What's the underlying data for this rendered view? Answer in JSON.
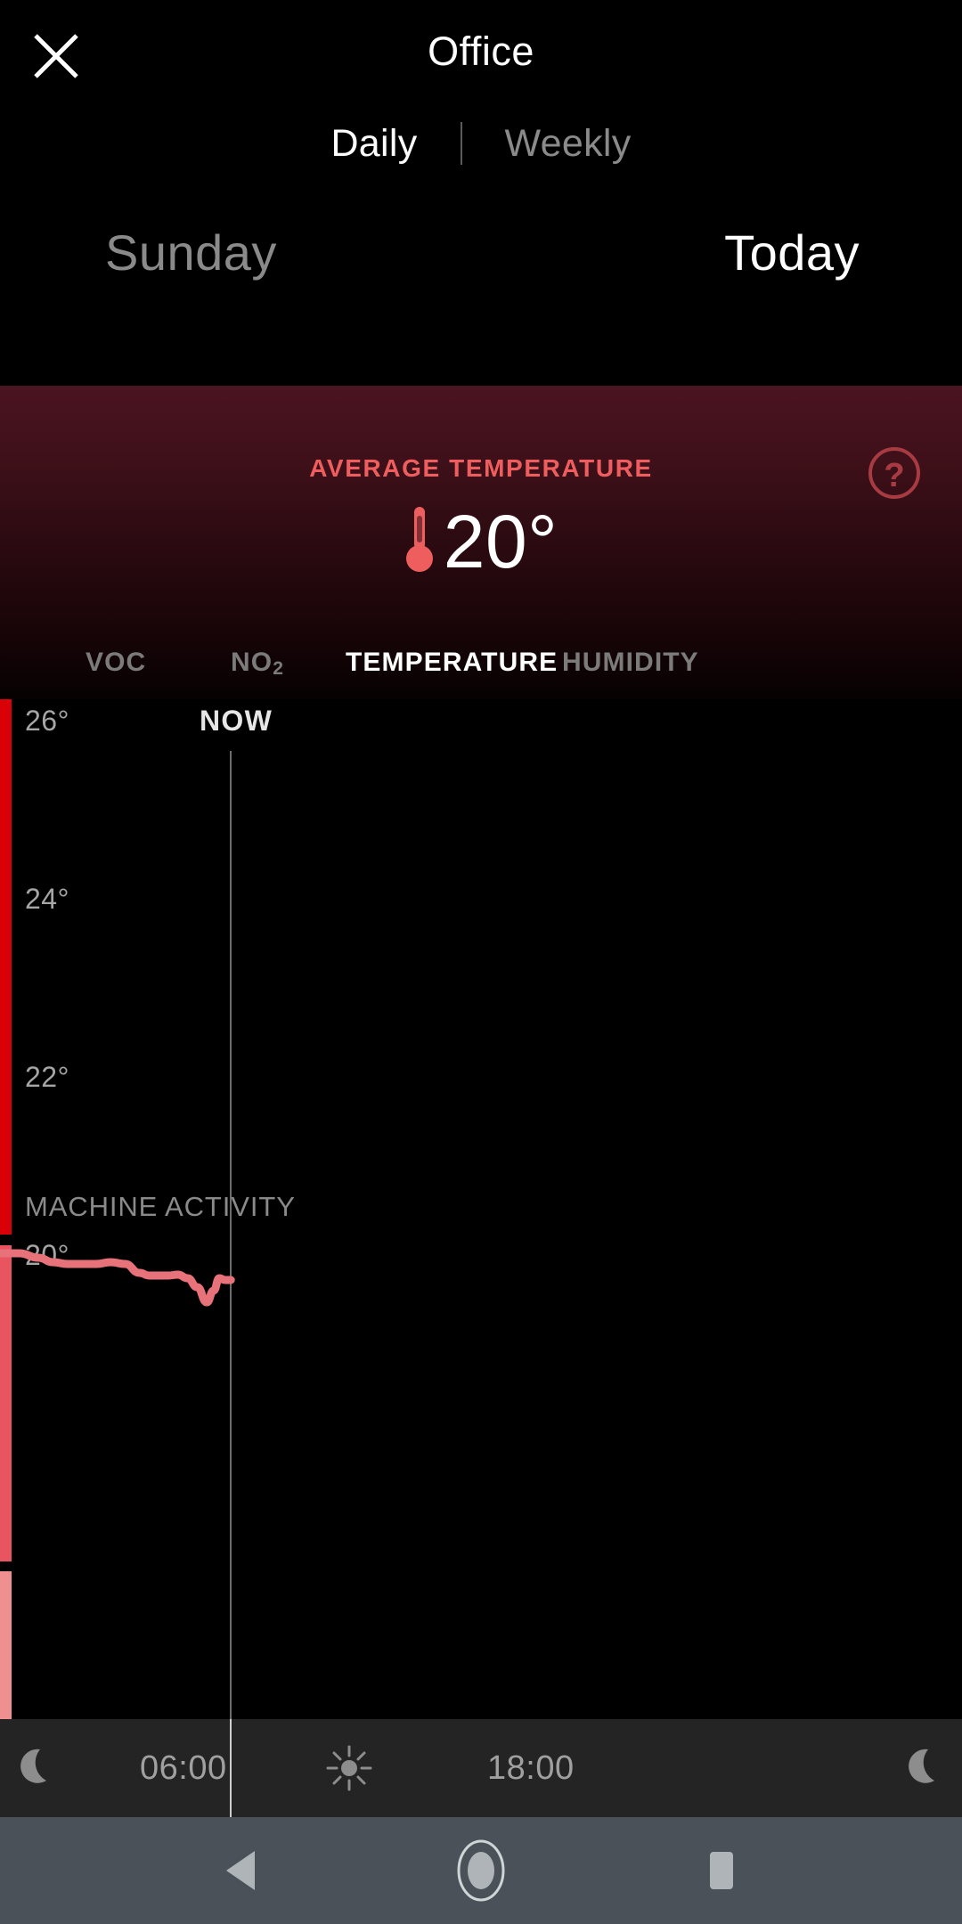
{
  "header": {
    "close_icon": "close-icon",
    "title": "Office",
    "range_tabs": [
      {
        "label": "Daily",
        "active": true
      },
      {
        "label": "Weekly",
        "active": false
      }
    ],
    "days": [
      {
        "label": "Sunday",
        "active": false
      },
      {
        "label": "Today",
        "active": true
      }
    ]
  },
  "banner": {
    "label": "AVERAGE TEMPERATURE",
    "value": "20°",
    "thermometer_icon": "thermometer-icon",
    "help_icon": "help-circle-icon",
    "accent_color": "#ef5e5e",
    "value_color": "#ffffff"
  },
  "metric_tabs": [
    {
      "label": "VOC",
      "active": false
    },
    {
      "label": "NO",
      "sub": "2",
      "active": false
    },
    {
      "label": "TEMPERATURE",
      "active": true
    },
    {
      "label": "HUMIDITY",
      "active": false
    }
  ],
  "chart_data": {
    "type": "line",
    "title": "",
    "xlabel": "",
    "ylabel": "",
    "ylim": [
      19.2,
      26.6
    ],
    "yticks": [
      "26°",
      "24°",
      "22°",
      "20°"
    ],
    "ytick_values": [
      26,
      24,
      22,
      20
    ],
    "grid": false,
    "legend": "none",
    "series": [
      {
        "name": "Temperature",
        "color": "#e8727a",
        "x": [
          0.0,
          0.02,
          0.04,
          0.055,
          0.07,
          0.085,
          0.1,
          0.115,
          0.13,
          0.145,
          0.155,
          0.165,
          0.175,
          0.185,
          0.195,
          0.205,
          0.215,
          0.222,
          0.228,
          0.234,
          0.24
        ],
        "values": [
          20.0,
          20.0,
          19.95,
          19.9,
          19.88,
          19.88,
          19.88,
          19.9,
          19.88,
          19.78,
          19.75,
          19.75,
          19.75,
          19.76,
          19.72,
          19.62,
          19.45,
          19.58,
          19.72,
          19.7,
          19.7
        ]
      }
    ],
    "now_marker": {
      "label": "NOW",
      "x": 0.24
    },
    "machine_activity_label": "MACHINE ACTIVITY",
    "scale_bar": {
      "name": "temperature-scale-bar",
      "segments": [
        {
          "color": "#da0008",
          "from": 0.0,
          "to": 0.525
        },
        {
          "color": "#e8545f",
          "from": 0.535,
          "to": 0.845
        },
        {
          "color": "#ef8f8f",
          "from": 0.855,
          "to": 1.0
        }
      ]
    }
  },
  "timeline": {
    "items": [
      {
        "type": "icon",
        "name": "moon-icon",
        "label": ""
      },
      {
        "type": "time",
        "name": "time-0600",
        "label": "06:00"
      },
      {
        "type": "icon",
        "name": "sun-icon",
        "label": ""
      },
      {
        "type": "time",
        "name": "time-1800",
        "label": "18:00"
      },
      {
        "type": "icon",
        "name": "moon-icon",
        "label": ""
      }
    ]
  },
  "navbar": {
    "back_icon": "back-triangle-icon",
    "home_icon": "home-circle-icon",
    "recents_icon": "recents-square-icon"
  }
}
